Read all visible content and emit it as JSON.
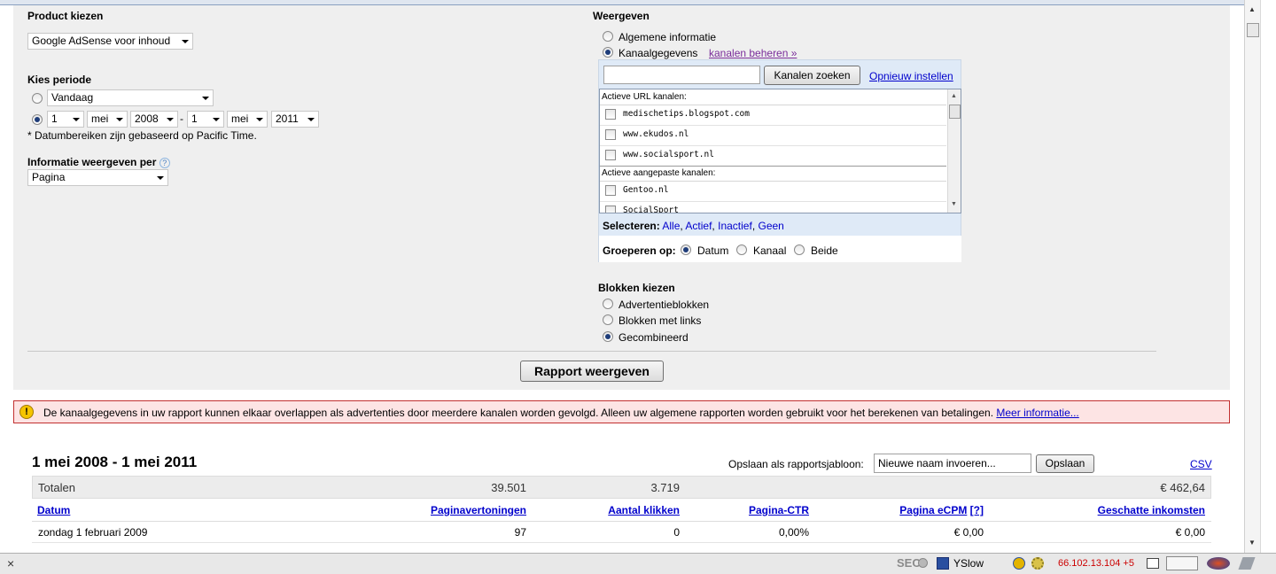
{
  "product": {
    "label": "Product kiezen",
    "selected": "Google AdSense voor inhoud"
  },
  "period": {
    "label": "Kies periode",
    "preset": "Vandaag",
    "from_day": "1",
    "from_month": "mei",
    "from_year": "2008",
    "sep": "-",
    "to_day": "1",
    "to_month": "mei",
    "to_year": "2011",
    "note": "* Datumbereiken zijn gebaseerd op Pacific Time."
  },
  "per": {
    "label": "Informatie weergeven per",
    "help": "?",
    "selected": "Pagina"
  },
  "view": {
    "label": "Weergeven",
    "opt_general": "Algemene informatie",
    "opt_channel": "Kanaalgegevens",
    "manage_link": "kanalen beheren »",
    "search_button": "Kanalen zoeken",
    "reset_link": "Opnieuw instellen",
    "url_header": "Actieve URL kanalen:",
    "url_channels": [
      "medischetips.blogspot.com",
      "www.ekudos.nl",
      "www.socialsport.nl"
    ],
    "custom_header": "Actieve aangepaste kanalen:",
    "custom_channels": [
      "Gentoo.nl",
      "SocialSport"
    ],
    "select_label": "Selecteren:",
    "select_all": "Alle",
    "select_active": "Actief",
    "select_inactive": "Inactief",
    "select_none": "Geen",
    "group_label": "Groeperen op:",
    "group_date": "Datum",
    "group_channel": "Kanaal",
    "group_both": "Beide"
  },
  "blocks": {
    "label": "Blokken kiezen",
    "opt_ads": "Advertentieblokken",
    "opt_links": "Blokken met links",
    "opt_combined": "Gecombineerd"
  },
  "run_button": "Rapport weergeven",
  "warning": {
    "icon": "!",
    "text": "De kanaalgegevens in uw rapport kunnen elkaar overlappen als advertenties door meerdere kanalen worden gevolgd. Alleen uw algemene rapporten worden gebruikt voor het berekenen van betalingen.",
    "link": "Meer informatie..."
  },
  "report": {
    "title": "1 mei 2008 - 1 mei 2011",
    "save_label": "Opslaan als rapportsjabloon:",
    "save_placeholder": "Nieuwe naam invoeren...",
    "save_button": "Opslaan",
    "csv": "CSV",
    "totals": {
      "label": "Totalen",
      "pageviews": "39.501",
      "clicks": "3.719",
      "ctr": "",
      "ecpm": "",
      "earnings": "€ 462,64"
    },
    "columns": {
      "date": "Datum",
      "pageviews": "Paginavertoningen",
      "clicks": "Aantal klikken",
      "ctr": "Pagina-CTR",
      "ecpm": "Pagina eCPM",
      "ecpm_help": "[?]",
      "earnings": "Geschatte inkomsten"
    },
    "rows": [
      {
        "date": "zondag 1 februari 2009",
        "pageviews": "97",
        "clicks": "0",
        "ctr": "0,00%",
        "ecpm": "€ 0,00",
        "earnings": "€ 0,00"
      }
    ]
  },
  "statusbar": {
    "close": "×",
    "seo": "SEO",
    "yslow": "YSlow",
    "ip": "66.102.13.104 +5"
  }
}
